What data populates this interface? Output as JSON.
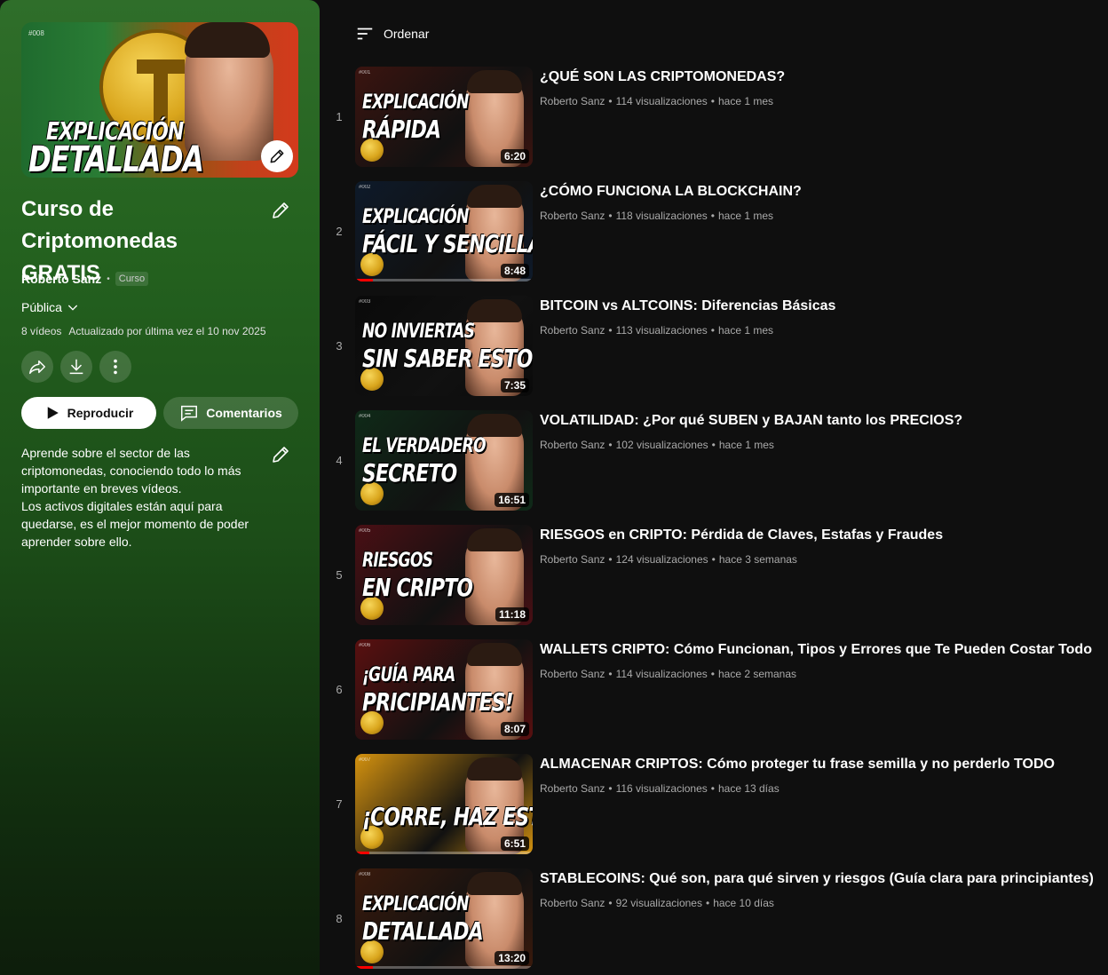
{
  "playlist": {
    "hero_tag": "#008",
    "hero_text_line1": "EXPLICACIÓN",
    "hero_text_line2": "DETALLADA",
    "title": "Curso de Criptomonedas GRATIS",
    "owner": "Roberto Sanz",
    "type_badge": "Curso",
    "privacy": "Pública",
    "video_count": "8 vídeos",
    "updated": "Actualizado por última vez el 10 nov 2025",
    "play_label": "Reproducir",
    "comments_label": "Comentarios",
    "description_lines": [
      "Aprende sobre el sector de las",
      "criptomonedas, conociendo todo lo más",
      "importante en breves vídeos.",
      "Los activos digitales están aquí para",
      "quedarse, es el mejor momento de poder",
      "aprender sobre ello."
    ]
  },
  "toolbar": {
    "sort_label": "Ordenar"
  },
  "videos": [
    {
      "index": "1",
      "title": "¿QUÉ SON LAS CRIPTOMONEDAS?",
      "channel": "Roberto Sanz",
      "views": "114 visualizaciones",
      "age": "hace 1 mes",
      "duration": "6:20",
      "thumb_tag": "#001",
      "thumb_text1": "EXPLICACIÓN",
      "thumb_text2": "RÁPIDA",
      "progress": 0,
      "bg": "#3b1410"
    },
    {
      "index": "2",
      "title": "¿CÓMO FUNCIONA LA BLOCKCHAIN?",
      "channel": "Roberto Sanz",
      "views": "118 visualizaciones",
      "age": "hace 1 mes",
      "duration": "8:48",
      "thumb_tag": "#002",
      "thumb_text1": "EXPLICACIÓN",
      "thumb_text2": "FÁCIL Y SENCILLA",
      "progress": 0.1,
      "bg": "#0e1a2a"
    },
    {
      "index": "3",
      "title": "BITCOIN vs ALTCOINS: Diferencias Básicas",
      "channel": "Roberto Sanz",
      "views": "113 visualizaciones",
      "age": "hace 1 mes",
      "duration": "7:35",
      "thumb_tag": "#003",
      "thumb_text1": "NO INVIERTAS",
      "thumb_text2": "SIN SABER ESTO",
      "progress": 0,
      "bg": "#0a0a0a"
    },
    {
      "index": "4",
      "title": "VOLATILIDAD: ¿Por qué SUBEN y BAJAN tanto los PRECIOS?",
      "channel": "Roberto Sanz",
      "views": "102 visualizaciones",
      "age": "hace 1 mes",
      "duration": "16:51",
      "thumb_tag": "#004",
      "thumb_text1": "EL VERDADERO",
      "thumb_text2": "SECRETO",
      "progress": 0,
      "bg": "#0f2a18"
    },
    {
      "index": "5",
      "title": "RIESGOS en CRIPTO: Pérdida de Claves, Estafas y Fraudes",
      "channel": "Roberto Sanz",
      "views": "124 visualizaciones",
      "age": "hace 3 semanas",
      "duration": "11:18",
      "thumb_tag": "#005",
      "thumb_text1": "RIESGOS",
      "thumb_text2": "EN CRIPTO",
      "progress": 0,
      "bg": "#4a0f14"
    },
    {
      "index": "6",
      "title": "WALLETS CRIPTO: Cómo Funcionan, Tipos y Errores que Te Pueden Costar Todo",
      "channel": "Roberto Sanz",
      "views": "114 visualizaciones",
      "age": "hace 2 semanas",
      "duration": "8:07",
      "thumb_tag": "#006",
      "thumb_text1": "¡GUÍA PARA",
      "thumb_text2": "PRICIPIANTES!",
      "progress": 0,
      "bg": "#5a1010"
    },
    {
      "index": "7",
      "title": "ALMACENAR CRIPTOS: Cómo proteger tu frase semilla y no perderlo TODO",
      "channel": "Roberto Sanz",
      "views": "116 visualizaciones",
      "age": "hace 13 días",
      "duration": "6:51",
      "thumb_tag": "#007",
      "thumb_text1": "",
      "thumb_text2": "¡CORRE, HAZ ESTO!",
      "progress": 0.08,
      "bg": "#c88a0c"
    },
    {
      "index": "8",
      "title": "STABLECOINS: Qué son, para qué sirven y riesgos (Guía clara para principiantes)",
      "channel": "Roberto Sanz",
      "views": "92 visualizaciones",
      "age": "hace 10 días",
      "duration": "13:20",
      "thumb_tag": "#008",
      "thumb_text1": "EXPLICACIÓN",
      "thumb_text2": "DETALLADA",
      "progress": 0.1,
      "bg": "#3a1a0c"
    }
  ]
}
